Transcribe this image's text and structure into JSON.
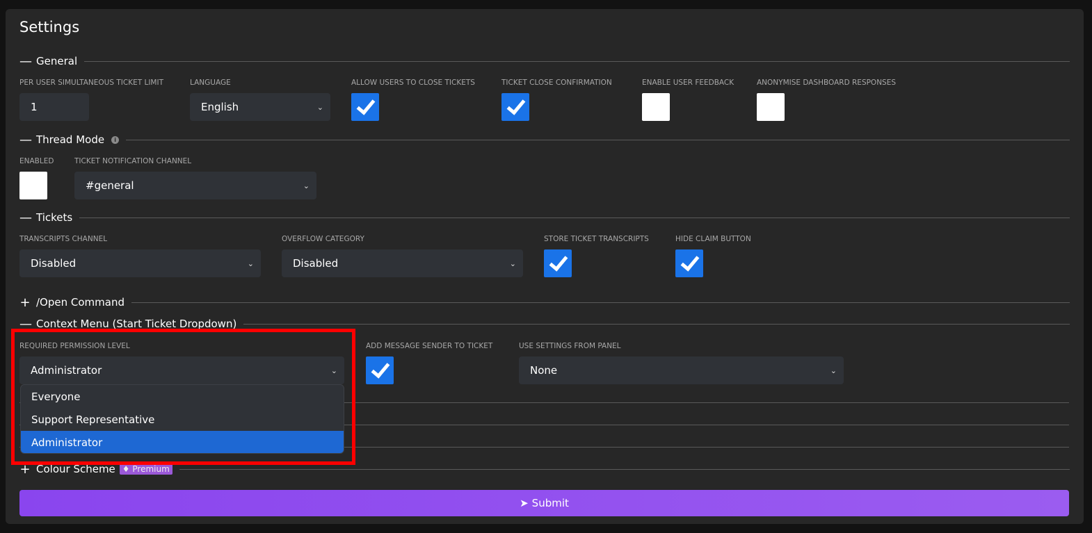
{
  "title": "Settings",
  "sections": {
    "general": {
      "label": "General",
      "toggle": "—",
      "ticket_limit_label": "PER USER SIMULTANEOUS TICKET LIMIT",
      "ticket_limit_value": "1",
      "language_label": "LANGUAGE",
      "language_value": "English",
      "allow_close_label": "ALLOW USERS TO CLOSE TICKETS",
      "allow_close": true,
      "close_confirm_label": "TICKET CLOSE CONFIRMATION",
      "close_confirm": true,
      "feedback_label": "ENABLE USER FEEDBACK",
      "feedback": false,
      "anonymise_label": "ANONYMISE DASHBOARD RESPONSES",
      "anonymise": false
    },
    "thread_mode": {
      "label": "Thread Mode",
      "toggle": "—",
      "info_icon": "i",
      "enabled_label": "ENABLED",
      "enabled": false,
      "channel_label": "TICKET NOTIFICATION CHANNEL",
      "channel_value": "#general"
    },
    "tickets": {
      "label": "Tickets",
      "toggle": "—",
      "transcripts_channel_label": "TRANSCRIPTS CHANNEL",
      "transcripts_channel_value": "Disabled",
      "overflow_label": "OVERFLOW CATEGORY",
      "overflow_value": "Disabled",
      "store_transcripts_label": "STORE TICKET TRANSCRIPTS",
      "store_transcripts": true,
      "hide_claim_label": "HIDE CLAIM BUTTON",
      "hide_claim": true
    },
    "open_command": {
      "label": "/Open Command",
      "toggle": "+"
    },
    "context_menu": {
      "label": "Context Menu (Start Ticket Dropdown)",
      "toggle": "—",
      "permission_label": "REQUIRED PERMISSION LEVEL",
      "permission_value": "Administrator",
      "permission_options": [
        "Everyone",
        "Support Representative",
        "Administrator"
      ],
      "add_sender_label": "ADD MESSAGE SENDER TO TICKET",
      "add_sender": true,
      "panel_label": "USE SETTINGS FROM PANEL",
      "panel_value": "None"
    },
    "colour_scheme": {
      "label": "Colour Scheme",
      "toggle": "+",
      "badge": "Premium"
    }
  },
  "submit_label": "Submit",
  "colors": {
    "accent": "#1a73e8",
    "submit": "#8a45ee",
    "highlight": "#ff0000"
  }
}
